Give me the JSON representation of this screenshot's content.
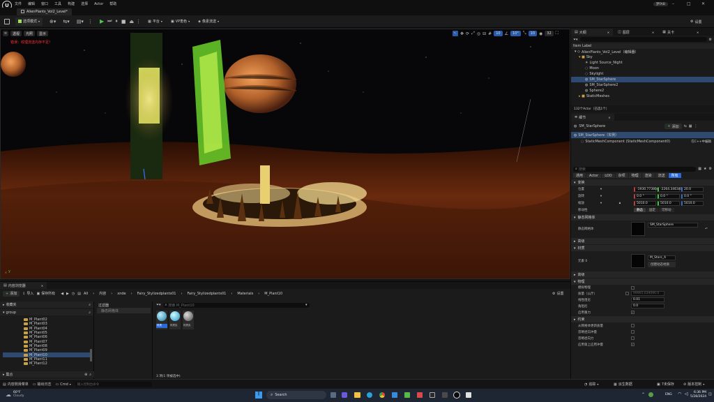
{
  "menu": [
    "文件",
    "编辑",
    "窗口",
    "工具",
    "构建",
    "选择",
    "Actor",
    "帮助"
  ],
  "user": "梦FAB",
  "tab": {
    "title": "AlienPlants_Vol2_Level*"
  },
  "toolbar": {
    "mode": "选项模式",
    "platform": "平台",
    "vp": "VP角色",
    "editor": "像素流送",
    "settings": "设置"
  },
  "viewport": {
    "perspective": "透视",
    "lit": "光照",
    "show": "显示",
    "warning": "错误：纹理流送内存不足！",
    "num1": "10",
    "num2": "10°",
    "num3": "10",
    "num4": "32"
  },
  "outliner": {
    "tab1": "大纲",
    "tab2": "图层",
    "tab3": "关卡",
    "column": "Item Label",
    "items": [
      {
        "label": "AlienPlants_Vol2_Level（编辑器）",
        "indent": 1
      },
      {
        "label": "Sky",
        "indent": 2,
        "folder": true
      },
      {
        "label": "Light Source_Night",
        "indent": 3
      },
      {
        "label": "Moon",
        "indent": 3
      },
      {
        "label": "Skylight",
        "indent": 3
      },
      {
        "label": "SM_StarSphere",
        "indent": 3,
        "selected": true
      },
      {
        "label": "SM_StarSphere2",
        "indent": 3
      },
      {
        "label": "Sphere2",
        "indent": 3
      },
      {
        "label": "StaticMeshes",
        "indent": 2,
        "folder": true
      }
    ],
    "footer": "132个Actor（已选1个）"
  },
  "details": {
    "tab": "细节",
    "actor_name": "SM_StarSphere",
    "add_button": "添加",
    "instance": "SM_StarSphere（实例）",
    "component": "StaticMeshComponent (StaticMeshComponent0)",
    "component_link": "在C++中编辑",
    "search_placeholder": "搜索",
    "filters": [
      "通用",
      "Actor",
      "LOD",
      "杂项",
      "物理",
      "渲染",
      "流送",
      "所有"
    ],
    "transform_header": "变换",
    "location_label": "位置",
    "location": [
      "-1930.773804",
      "-2264.346345",
      "20.0"
    ],
    "rotation_label": "旋转",
    "rotation": [
      "0.0 °",
      "0.0 °",
      "0.0 °"
    ],
    "scale_label": "缩放",
    "scale": [
      "5010.0",
      "5010.0",
      "5010.0"
    ],
    "mobility_label": "移动性",
    "mobility": [
      "静态",
      "固定",
      "可移动"
    ],
    "static_mesh_header": "静态网格体",
    "static_mesh_label": "静态网格体",
    "static_mesh_value": "SM_StarSphere",
    "advanced_header": "高级",
    "materials_header": "材质",
    "element0_label": "元素 0",
    "material_value": "M_Stars_A",
    "create_dynamic": "创建动态材质",
    "advanced2_header": "高级",
    "physics_header": "物理",
    "simulate_label": "模拟物理",
    "mass_label": "质量（公斤）",
    "mass_value": "99965.039090.0",
    "linear_damping_label": "线性阻尼",
    "linear_damping_value": "0.01",
    "angular_damping_label": "角阻尼",
    "angular_damping_value": "0.0",
    "gravity_label": "启用重力",
    "constraints_header": "约束",
    "c1": "从网格体更新质量",
    "c2": "忽略径向冲量",
    "c3": "忽略径向力",
    "c4": "应用第上应用冲量"
  },
  "content_browser": {
    "tab": "内容浏览器",
    "add": "添加",
    "import": "导入",
    "save_all": "保存所有",
    "path": [
      "All",
      "内容",
      "xnde",
      "Fairy_Stylizedplants01",
      "Fairy_Stylizedplants01",
      "Materials",
      "M_Plant10"
    ],
    "settings": "设置",
    "favorites": "收藏夹",
    "project": "group",
    "folders": [
      "M_Plant02",
      "M_Plant03",
      "M_Plant04",
      "M_Plant05",
      "M_Plant06",
      "M_Plant07",
      "M_Plant08",
      "M_Plant09",
      "M_Plant10",
      "M_Plant11",
      "M_Plant12"
    ],
    "selected_folder": "M_Plant10",
    "collections": "集合",
    "filter_header": "过滤器",
    "filter_item": "静态网格体",
    "search_placeholder": "搜索 M_Plant10",
    "assets": [
      {
        "label": "材质",
        "color": "#d7a64a",
        "selected": true
      },
      {
        "label": "材质实",
        "color": "#3aa0d6"
      },
      {
        "label": "材质实",
        "color": "#8a8a8a"
      }
    ],
    "footer": "3 项(1 项被选中)"
  },
  "statusbar": {
    "drawer": "内容侧滑菜单",
    "output": "输出日志",
    "cmd": "Cmd",
    "cmd_placeholder": "输入控制台命令",
    "trace": "追踪",
    "derive": "派生数据",
    "unsaved": "7未保存",
    "source": "版本控制"
  },
  "taskbar": {
    "weather_temp": "60°F",
    "weather_desc": "Cloudy",
    "search": "Search",
    "lang": "ENG",
    "time": "6:36 PM",
    "date": "5/28/2024"
  }
}
